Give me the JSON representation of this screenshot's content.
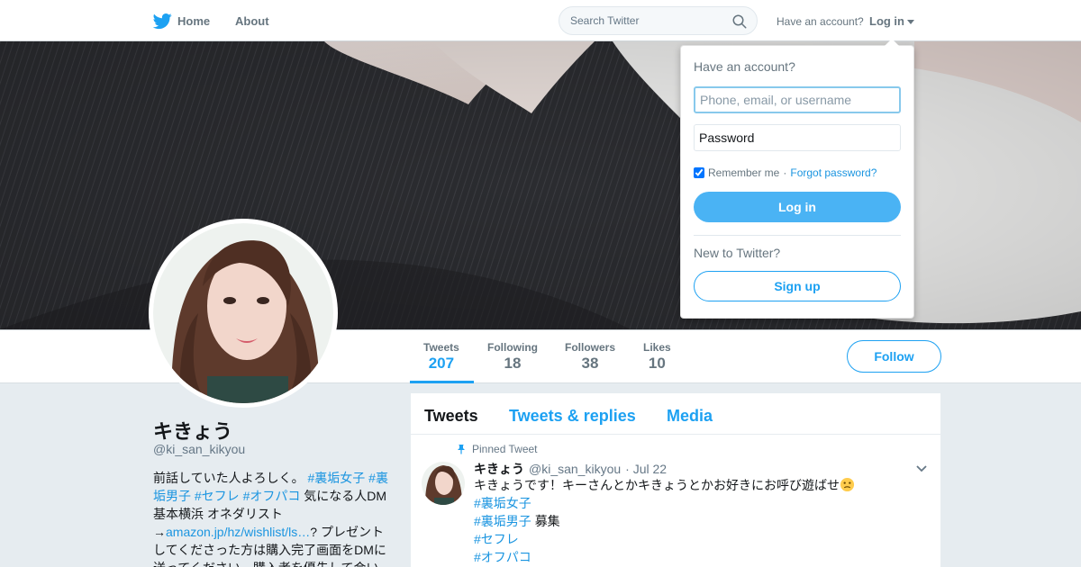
{
  "nav": {
    "home_label": "Home",
    "about_label": "About",
    "search_placeholder": "Search Twitter",
    "have_account": "Have an account?",
    "login_label": "Log in"
  },
  "profile": {
    "name": "キきょう",
    "handle": "@ki_san_kikyou",
    "bio": {
      "t1": "前話していた人よろしく。",
      "h1": "#裏垢女子",
      "h2": "#裏垢男子",
      "h3": "#セフレ",
      "h4": "#オフパコ",
      "t2": "気になる人DM 基本横浜 オネダリスト→",
      "link": "amazon.jp/hz/wishlist/ls…",
      "t3": "? プレゼントしてくださった方は購入完了画面をDMに送ってください。購入者を優先して会いま"
    }
  },
  "stats": [
    {
      "label": "Tweets",
      "value": "207"
    },
    {
      "label": "Following",
      "value": "18"
    },
    {
      "label": "Followers",
      "value": "38"
    },
    {
      "label": "Likes",
      "value": "10"
    }
  ],
  "follow_label": "Follow",
  "tabs": [
    "Tweets",
    "Tweets & replies",
    "Media"
  ],
  "tweet": {
    "pinned_label": "Pinned Tweet",
    "name": "キきょう",
    "handle": "@ki_san_kikyou",
    "date": "· Jul 22",
    "text": "キきょうです！キーさんとかキきょうとかお好きにお呼び遊ばせ",
    "tag1": "#裏垢女子",
    "tag2": "#裏垢男子",
    "tag2_suffix": "募集",
    "tag3": "#セフレ",
    "tag4": "#オフパコ"
  },
  "login_dropdown": {
    "title": "Have an account?",
    "username_placeholder": "Phone, email, or username",
    "password_placeholder": "Password",
    "remember": "Remember me",
    "sep": " · ",
    "forgot": "Forgot password?",
    "login_button": "Log in",
    "new_label": "New to Twitter?",
    "signup_button": "Sign up"
  },
  "colors": {
    "accent": "#1da1f2",
    "login_button": "#4ab3f4",
    "link": "#1b95e0",
    "background": "#e6ecf0"
  },
  "icons": [
    "twitter-bird-icon",
    "search-icon",
    "caret-down-icon",
    "pin-icon",
    "chevron-down-icon",
    "emoji-icon"
  ]
}
